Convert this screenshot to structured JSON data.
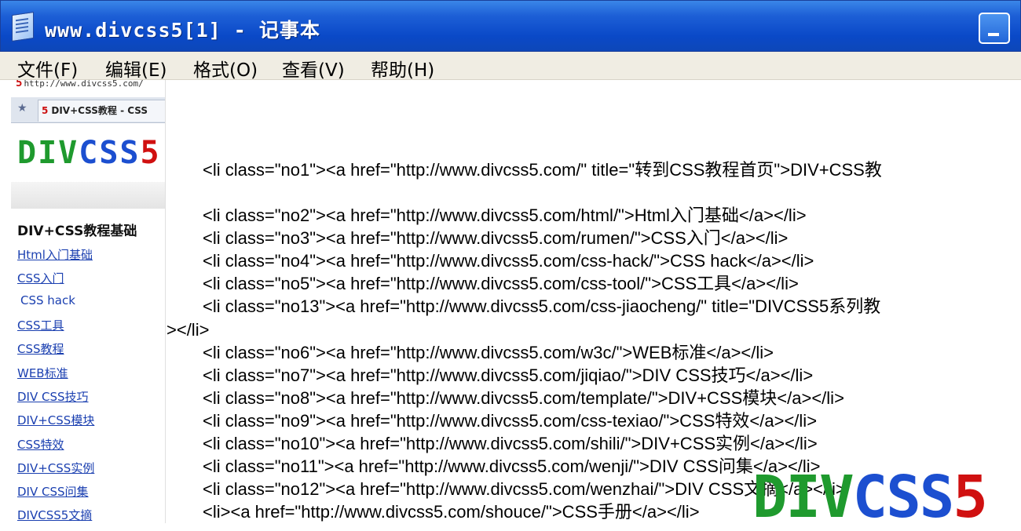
{
  "window": {
    "title": "www.divcss5[1] - 记事本",
    "minimize_label": "minimize"
  },
  "menu": [
    {
      "label": "文件(F)"
    },
    {
      "label": "编辑(E)"
    },
    {
      "label": "格式(O)"
    },
    {
      "label": "查看(V)"
    },
    {
      "label": "帮助(H)"
    }
  ],
  "browser": {
    "address": "http://www.divcss5.com/",
    "tab_title": "DIV+CSS教程 - CSS",
    "logo_parts": [
      {
        "text": "DIV",
        "color": "#1f9a2e"
      },
      {
        "text": "CSS",
        "color": "#1c4fd0"
      },
      {
        "text": "5",
        "color": "#d01010"
      }
    ],
    "heading": "DIV+CSS教程基础",
    "links": [
      "Html入门基础",
      "CSS入门",
      "CSS hack",
      "CSS工具",
      "CSS教程",
      "WEB标准",
      "DIV CSS技巧",
      "DIV+CSS模块",
      "CSS特效",
      "DIV+CSS实例",
      "DIV CSS问集",
      "DIVCSS5文摘"
    ]
  },
  "code_lines": [
    "<li class=\"no1\"><a href=\"http://www.divcss5.com/\" title=\"转到CSS教程首页\">DIV+CSS教",
    "<li class=\"no2\"><a href=\"http://www.divcss5.com/html/\">Html入门基础</a></li>",
    "<li class=\"no3\"><a href=\"http://www.divcss5.com/rumen/\">CSS入门</a></li>",
    "<li class=\"no4\"><a href=\"http://www.divcss5.com/css-hack/\">CSS hack</a></li>",
    "<li class=\"no5\"><a href=\"http://www.divcss5.com/css-tool/\">CSS工具</a></li>",
    "<li class=\"no13\"><a href=\"http://www.divcss5.com/css-jiaocheng/\" title=\"DIVCSS5系列教",
    "></li>",
    "<li class=\"no6\"><a href=\"http://www.divcss5.com/w3c/\">WEB标准</a></li>",
    "<li class=\"no7\"><a href=\"http://www.divcss5.com/jiqiao/\">DIV CSS技巧</a></li>",
    "<li class=\"no8\"><a href=\"http://www.divcss5.com/template/\">DIV+CSS模块</a></li>",
    "<li class=\"no9\"><a href=\"http://www.divcss5.com/css-texiao/\">CSS特效</a></li>",
    "<li class=\"no10\"><a href=\"http://www.divcss5.com/shili/\">DIV+CSS实例</a></li>",
    "<li class=\"no11\"><a href=\"http://www.divcss5.com/wenji/\">DIV CSS问集</a></li>",
    "<li class=\"no12\"><a href=\"http://www.divcss5.com/wenzhai/\">DIV CSS文摘</a></li>",
    "<li><a href=\"http://www.divcss5.com/shouce/\">CSS手册</a></li>"
  ],
  "watermark_parts": [
    {
      "text": "DIV",
      "color": "#1f9a2e"
    },
    {
      "text": "CSS",
      "color": "#1c4fd0"
    },
    {
      "text": "5",
      "color": "#d01010"
    }
  ]
}
